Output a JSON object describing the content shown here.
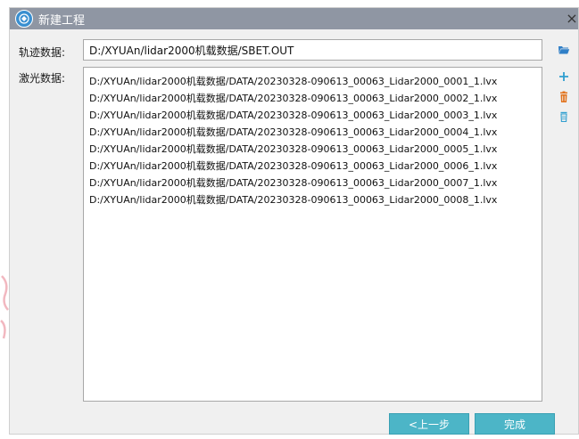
{
  "window": {
    "title": "新建工程",
    "close_glyph": "×"
  },
  "form": {
    "track_label": "轨迹数据:",
    "track_value": "D:/XYUAn/lidar2000机载数据/SBET.OUT",
    "laser_label": "激光数据:"
  },
  "laser_files": [
    "D:/XYUAn/lidar2000机载数据/DATA/20230328-090613_00063_Lidar2000_0001_1.lvx",
    "D:/XYUAn/lidar2000机载数据/DATA/20230328-090613_00063_Lidar2000_0002_1.lvx",
    "D:/XYUAn/lidar2000机载数据/DATA/20230328-090613_00063_Lidar2000_0003_1.lvx",
    "D:/XYUAn/lidar2000机载数据/DATA/20230328-090613_00063_Lidar2000_0004_1.lvx",
    "D:/XYUAn/lidar2000机载数据/DATA/20230328-090613_00063_Lidar2000_0005_1.lvx",
    "D:/XYUAn/lidar2000机载数据/DATA/20230328-090613_00063_Lidar2000_0006_1.lvx",
    "D:/XYUAn/lidar2000机载数据/DATA/20230328-090613_00063_Lidar2000_0007_1.lvx",
    "D:/XYUAn/lidar2000机载数据/DATA/20230328-090613_00063_Lidar2000_0008_1.lvx"
  ],
  "icons": {
    "folder": "folder-open-icon",
    "add": "plus-icon",
    "delete": "trash-icon",
    "clear": "trash-outline-icon"
  },
  "buttons": {
    "prev_label": "<上一步",
    "finish_label": "完成"
  },
  "colors": {
    "titlebar": "#8f96a3",
    "accent": "#4cb5c7",
    "folder_icon": "#2f7fc7",
    "add_icon": "#2f9fd0",
    "delete_icon": "#e2731d",
    "clear_icon": "#2f9fd0"
  }
}
